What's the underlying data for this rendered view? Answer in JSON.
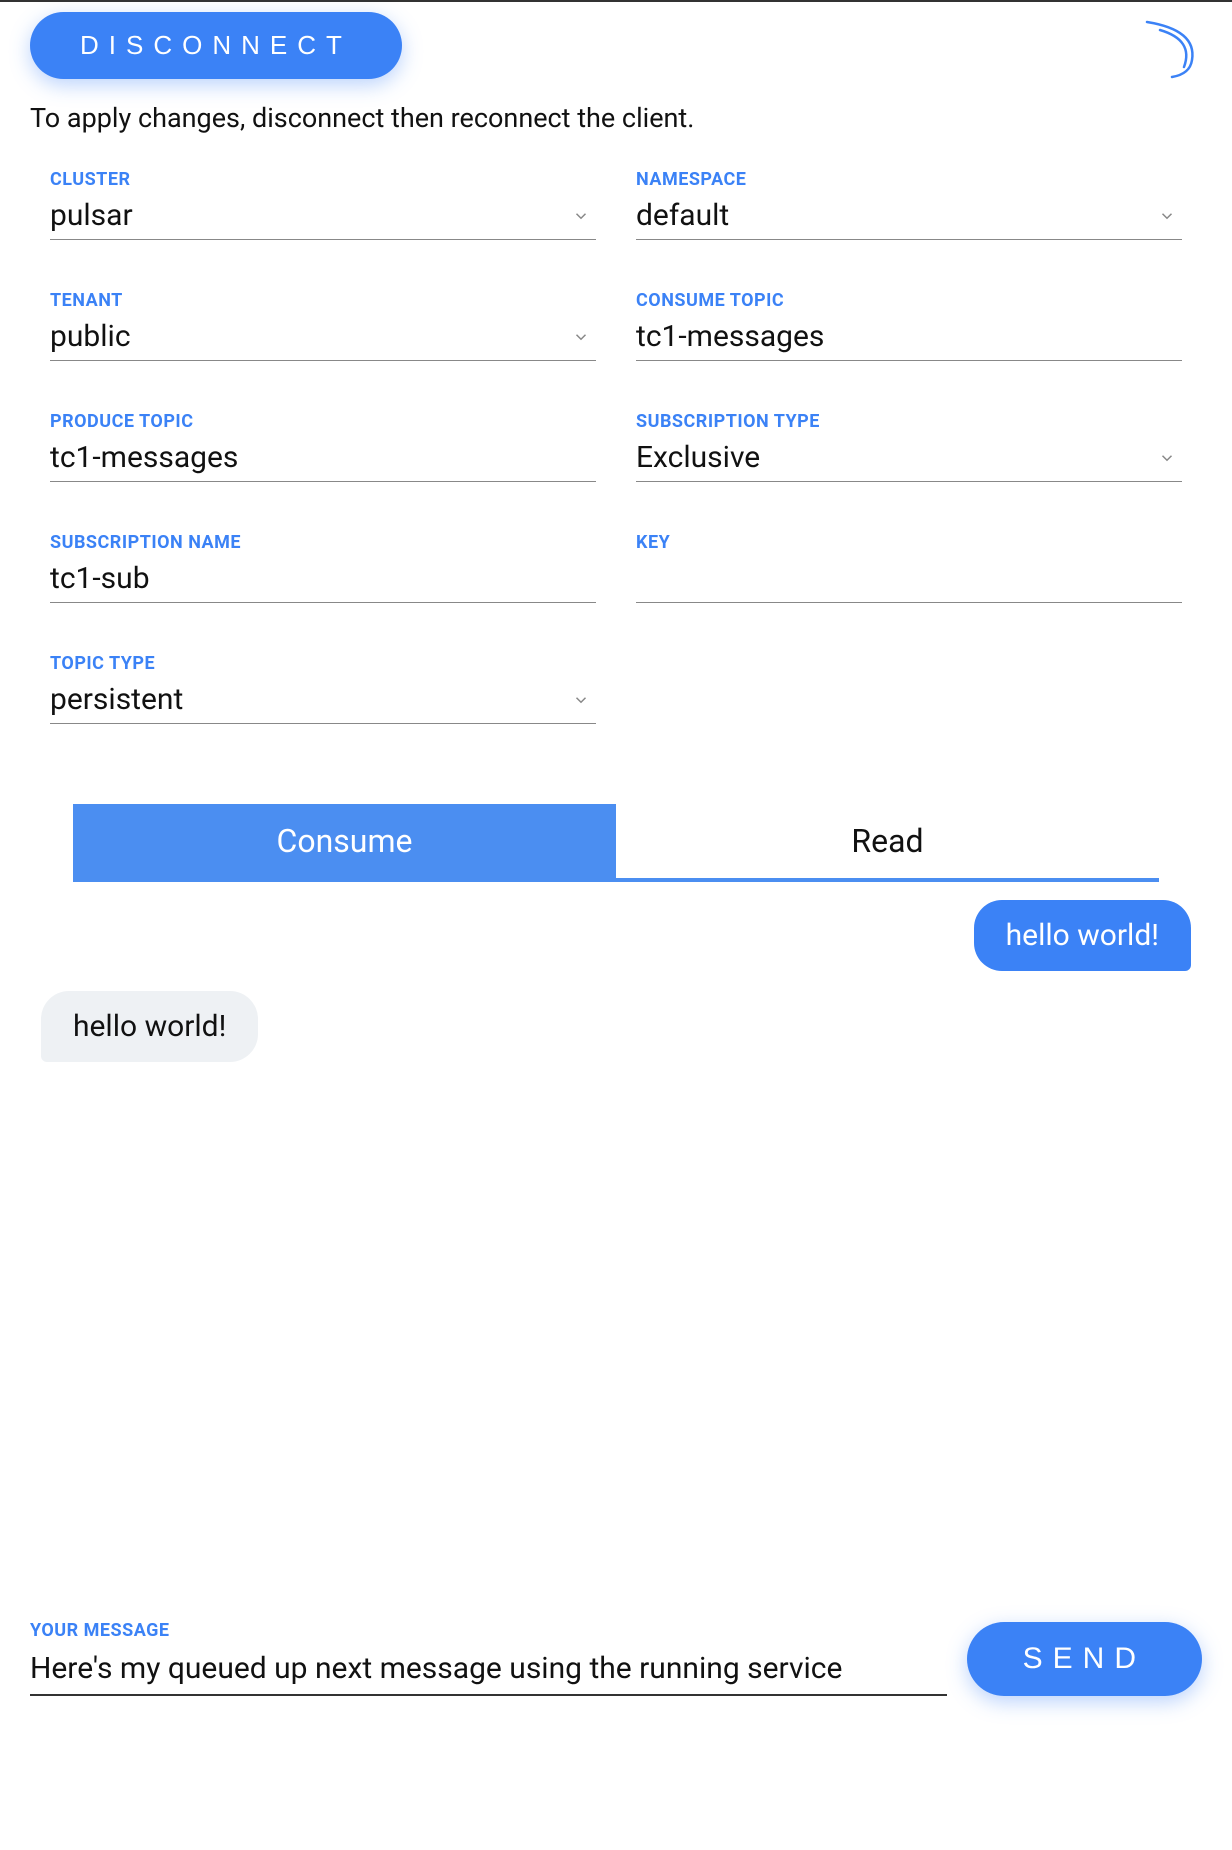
{
  "header": {
    "disconnect_label": "DISCONNECT",
    "instruction": "To apply changes, disconnect then reconnect the client."
  },
  "fields": {
    "cluster": {
      "label": "CLUSTER",
      "value": "pulsar",
      "has_dropdown": true
    },
    "namespace": {
      "label": "NAMESPACE",
      "value": "default",
      "has_dropdown": true
    },
    "tenant": {
      "label": "TENANT",
      "value": "public",
      "has_dropdown": true
    },
    "consume_topic": {
      "label": "CONSUME TOPIC",
      "value": "tc1-messages",
      "has_dropdown": false
    },
    "produce_topic": {
      "label": "PRODUCE TOPIC",
      "value": "tc1-messages",
      "has_dropdown": false
    },
    "subscription_type": {
      "label": "SUBSCRIPTION TYPE",
      "value": "Exclusive",
      "has_dropdown": true
    },
    "subscription_name": {
      "label": "SUBSCRIPTION NAME",
      "value": "tc1-sub",
      "has_dropdown": false
    },
    "key": {
      "label": "KEY",
      "value": "",
      "has_dropdown": false
    },
    "topic_type": {
      "label": "TOPIC TYPE",
      "value": "persistent",
      "has_dropdown": true
    }
  },
  "tabs": {
    "consume": "Consume",
    "read": "Read",
    "active": "consume"
  },
  "messages": [
    {
      "text": "hello world!",
      "direction": "sent"
    },
    {
      "text": "hello world!",
      "direction": "received"
    }
  ],
  "compose": {
    "label": "YOUR MESSAGE",
    "value": "Here's my queued up next message using the running service",
    "send_label": "SEND"
  },
  "colors": {
    "accent": "#3b82f6"
  }
}
